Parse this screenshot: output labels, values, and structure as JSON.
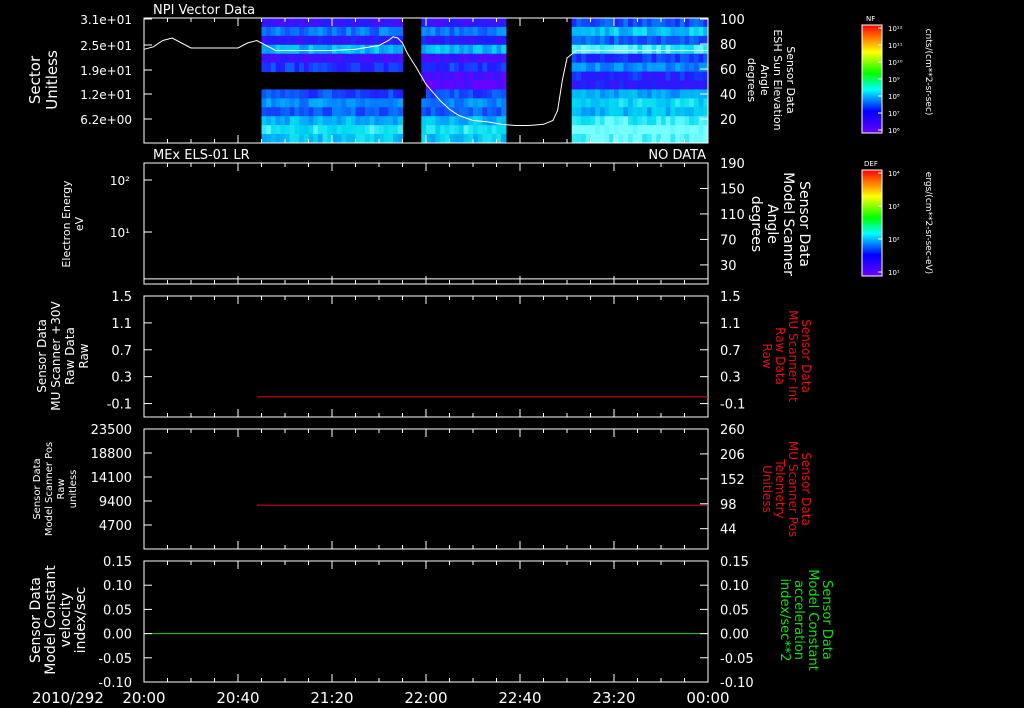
{
  "colors": {
    "background": "#000000",
    "axis": "#ffffff",
    "red": "#e01010",
    "green": "#10e010",
    "white_trace": "#ffffff"
  },
  "x_axis": {
    "date_label": "2010/292",
    "tick_labels": [
      "20:00",
      "20:40",
      "21:20",
      "22:00",
      "22:40",
      "23:20",
      "00:00"
    ],
    "range_minutes": [
      0,
      240
    ]
  },
  "colorbars": [
    {
      "label": "NF",
      "units": "cnts/(cm**2-sr-sec)",
      "ticks": [
        "10¹²",
        "10¹¹",
        "10¹⁰",
        "10⁹",
        "10⁸",
        "10⁷",
        "10⁶"
      ]
    },
    {
      "label": "DEF",
      "units": "ergs/(cm**2-sr-sec-eV)",
      "ticks": [
        "10⁴",
        "10³",
        "10²",
        "10¹"
      ]
    }
  ],
  "chart_data": [
    {
      "type": "heatmap",
      "title": "NPI Vector Data",
      "ylabel_left": [
        "Sector",
        "Unitless"
      ],
      "yticks_left": [
        "3.1e+01",
        "2.5e+01",
        "1.9e+01",
        "1.2e+01",
        "6.2e+00"
      ],
      "ylabel_right": [
        "Sensor Data",
        "ESH Sun Elevation",
        "Angle",
        "degrees"
      ],
      "yticks_right": [
        "100",
        "80",
        "60",
        "40",
        "20"
      ],
      "ylim_right": [
        0,
        100
      ],
      "data_intervals_minutes": [
        [
          50,
          110
        ],
        [
          118,
          154
        ],
        [
          182,
          240
        ]
      ],
      "gap_minutes": [
        154,
        182
      ],
      "series": [
        {
          "name": "ESH Sun Elevation",
          "x_minutes": [
            0,
            4,
            8,
            12,
            16,
            20,
            24,
            30,
            36,
            40,
            44,
            48,
            52,
            56,
            60,
            70,
            80,
            90,
            100,
            104,
            106,
            108,
            110,
            112,
            116,
            120,
            126,
            130,
            134,
            140,
            146,
            152,
            158,
            164,
            170,
            174,
            176,
            178,
            180,
            184,
            190,
            200,
            210,
            220,
            230,
            240
          ],
          "values": [
            75,
            77,
            82,
            84,
            80,
            76,
            76,
            76,
            76,
            76,
            80,
            82,
            78,
            74,
            74,
            74,
            74,
            75,
            78,
            82,
            85,
            84,
            80,
            72,
            60,
            47,
            34,
            27,
            22,
            18,
            17,
            15,
            14,
            14,
            15,
            18,
            26,
            50,
            68,
            74,
            74,
            74,
            74,
            74,
            74,
            74
          ]
        }
      ]
    },
    {
      "type": "line",
      "title": "MEx ELS-01 LR",
      "status": "NO DATA",
      "ylabel_left": [
        "Electron Energy",
        "eV"
      ],
      "yticks_left": [
        "10²",
        "10¹"
      ],
      "ylabel_right": [
        "Sensor Data",
        "Model Scanner",
        "Angle",
        "degrees"
      ],
      "yticks_right": [
        "190",
        "150",
        "110",
        "70",
        "30"
      ],
      "ylim_right": [
        0,
        190
      ],
      "series": [
        {
          "name": "Model Scanner Angle",
          "x_minutes": [
            0,
            240
          ],
          "values": [
            8,
            8
          ]
        }
      ]
    },
    {
      "type": "line",
      "ylabel_left": [
        "Sensor Data",
        "MU Scanner +30V",
        "Raw Data",
        "Raw"
      ],
      "yticks_left": [
        "1.5",
        "1.1",
        "0.7",
        "0.3",
        "-0.1"
      ],
      "ylim": [
        -0.3,
        1.5
      ],
      "ylabel_right": [
        "Sensor Data",
        "MU Scanner Int",
        "Raw Data",
        "Raw"
      ],
      "yticks_right": [
        "1.5",
        "1.1",
        "0.7",
        "0.3",
        "-0.1"
      ],
      "series": [
        {
          "name": "MU Scanner Int",
          "x_minutes": [
            48,
            240
          ],
          "values": [
            0.0,
            0.0
          ]
        }
      ]
    },
    {
      "type": "line",
      "ylabel_left": [
        "Sensor Data",
        "Model Scanner Pos",
        "Raw",
        "unitless"
      ],
      "yticks_left": [
        "23500",
        "18800",
        "14100",
        "9400",
        "4700"
      ],
      "ylim": [
        0,
        23500
      ],
      "ylabel_right": [
        "Sensor Data",
        "MU Scanner Pos",
        "Telemetry",
        "Unitless"
      ],
      "yticks_right": [
        "260",
        "206",
        "152",
        "98",
        "44"
      ],
      "ylim_right": [
        0,
        260
      ],
      "series": [
        {
          "name": "MU Scanner Pos",
          "x_minutes": [
            48,
            240
          ],
          "values": [
            95,
            95
          ]
        }
      ]
    },
    {
      "type": "line",
      "ylabel_left": [
        "Sensor Data",
        "Model Constant",
        "velocity",
        "index/sec"
      ],
      "yticks_left": [
        "0.15",
        "0.10",
        "0.05",
        "0.00",
        "-0.05",
        "-0.10"
      ],
      "ylim": [
        -0.1,
        0.15
      ],
      "ylabel_right": [
        "Sensor Data",
        "Model Constant",
        "acceleration",
        "index/sec**2"
      ],
      "yticks_right": [
        "0.15",
        "0.10",
        "0.05",
        "0.00",
        "-0.05",
        "-0.10"
      ],
      "series": [
        {
          "name": "Model Constant acceleration",
          "x_minutes": [
            0,
            240
          ],
          "values": [
            0.0,
            0.0
          ]
        }
      ]
    }
  ]
}
